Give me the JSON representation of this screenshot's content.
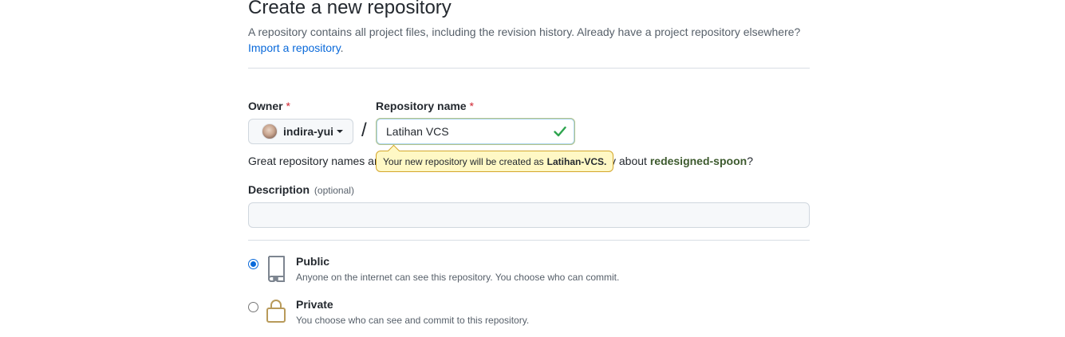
{
  "header": {
    "title": "Create a new repository",
    "subtitle": "A repository contains all project files, including the revision history. Already have a project repository elsewhere?",
    "import_link": "Import a repository",
    "import_suffix": "."
  },
  "owner": {
    "label": "Owner",
    "required_mark": "*",
    "value": "indira-yui"
  },
  "separator": "/",
  "repository": {
    "label": "Repository name",
    "required_mark": "*",
    "value": "Latihan VCS",
    "valid_icon": "check-icon",
    "tooltip_prefix": "Your new repository will be created as",
    "tooltip_name": "Latihan-VCS."
  },
  "hint": {
    "prefix": "Great repository names ar",
    "middle": "y about",
    "suggestion": "redesigned-spoon",
    "suffix": "?"
  },
  "description": {
    "label": "Description",
    "optional": "(optional)",
    "value": ""
  },
  "visibility": [
    {
      "title": "Public",
      "description": "Anyone on the internet can see this repository. You choose who can commit.",
      "icon": "repo-icon",
      "checked": true
    },
    {
      "title": "Private",
      "description": "You choose who can see and commit to this repository.",
      "icon": "lock-icon",
      "checked": false
    }
  ],
  "colors": {
    "link": "#0969da",
    "required": "#cf222e",
    "valid_check": "#2da44e",
    "tooltip_bg": "#fff8c5",
    "suggestion": "#3d5a2e"
  }
}
